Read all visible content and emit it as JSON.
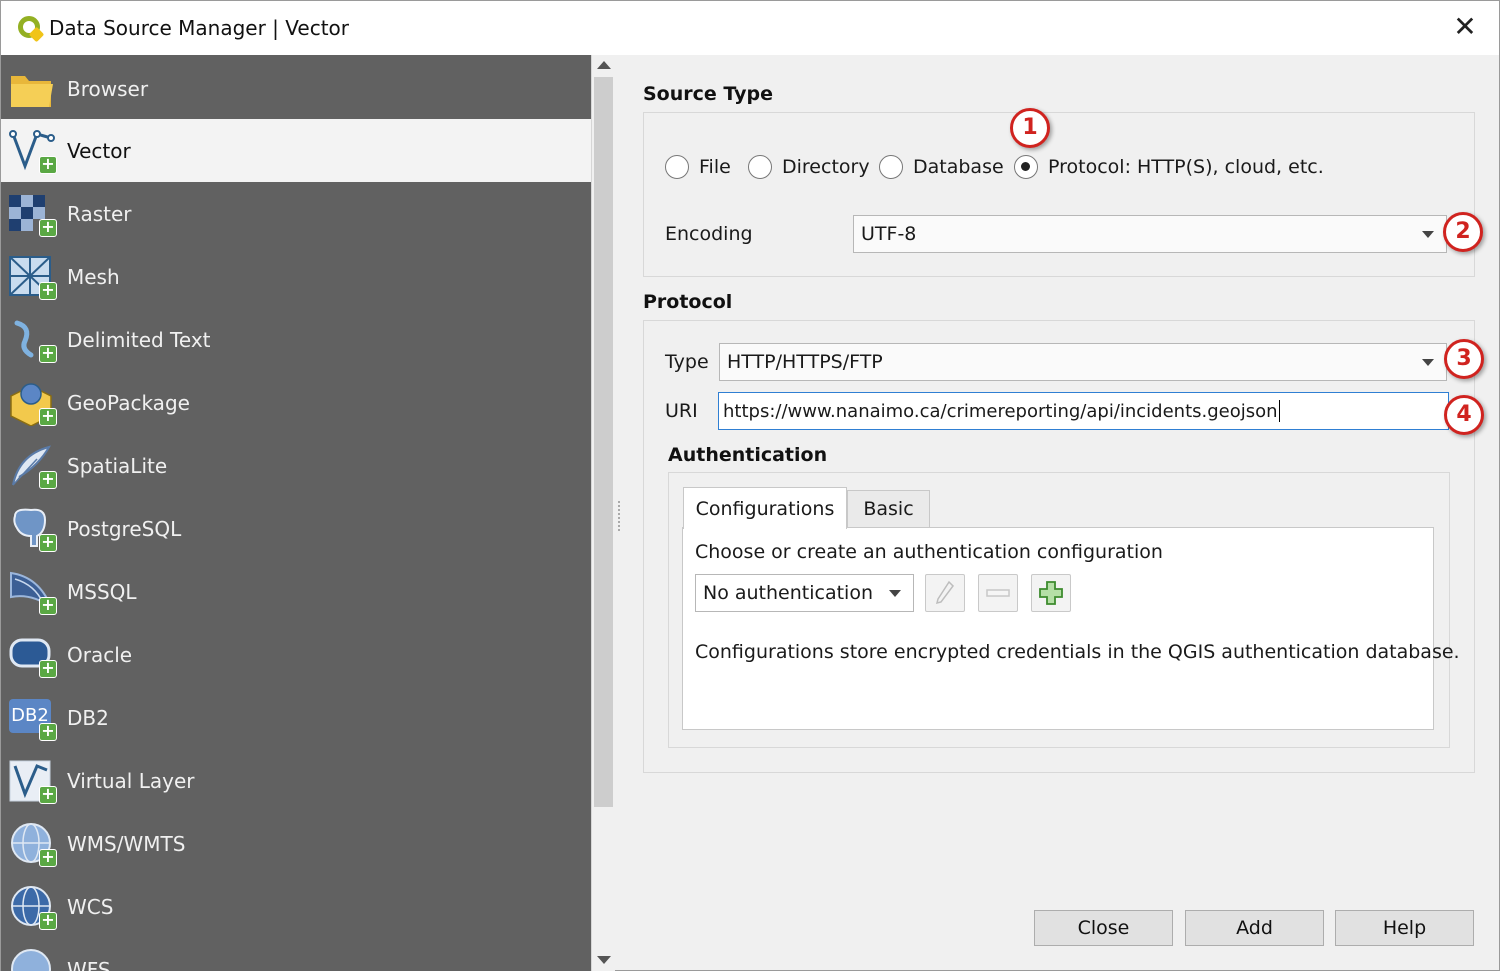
{
  "window": {
    "title": "Data Source Manager | Vector",
    "close_glyph": "✕"
  },
  "sidebar": {
    "items": [
      {
        "label": "Browser",
        "icon": "folder-icon"
      },
      {
        "label": "Vector",
        "icon": "vector-icon",
        "selected": true
      },
      {
        "label": "Raster",
        "icon": "raster-icon"
      },
      {
        "label": "Mesh",
        "icon": "mesh-icon"
      },
      {
        "label": "Delimited Text",
        "icon": "delimited-text-icon"
      },
      {
        "label": "GeoPackage",
        "icon": "geopackage-icon"
      },
      {
        "label": "SpatiaLite",
        "icon": "spatialite-icon"
      },
      {
        "label": "PostgreSQL",
        "icon": "postgresql-icon"
      },
      {
        "label": "MSSQL",
        "icon": "mssql-icon"
      },
      {
        "label": "Oracle",
        "icon": "oracle-icon"
      },
      {
        "label": "DB2",
        "icon": "db2-icon"
      },
      {
        "label": "Virtual Layer",
        "icon": "virtual-layer-icon"
      },
      {
        "label": "WMS/WMTS",
        "icon": "wms-icon"
      },
      {
        "label": "WCS",
        "icon": "wcs-icon"
      },
      {
        "label": "WFS",
        "icon": "wfs-icon"
      }
    ],
    "db2_icon_text": "DB2"
  },
  "source_type": {
    "title": "Source Type",
    "options": [
      {
        "label": "File",
        "checked": false
      },
      {
        "label": "Directory",
        "checked": false
      },
      {
        "label": "Database",
        "checked": false
      },
      {
        "label": "Protocol: HTTP(S), cloud, etc.",
        "checked": true
      }
    ],
    "encoding_label": "Encoding",
    "encoding_value": "UTF-8"
  },
  "protocol": {
    "title": "Protocol",
    "type_label": "Type",
    "type_value": "HTTP/HTTPS/FTP",
    "uri_label": "URI",
    "uri_value": "https://www.nanaimo.ca/crimereporting/api/incidents.geojson"
  },
  "authentication": {
    "title": "Authentication",
    "tabs": [
      {
        "label": "Configurations",
        "active": true
      },
      {
        "label": "Basic",
        "active": false
      }
    ],
    "prompt": "Choose or create an authentication configuration",
    "selected_config": "No authentication",
    "note": "Configurations store encrypted credentials in the QGIS authentication database."
  },
  "badges": [
    "1",
    "2",
    "3",
    "4"
  ],
  "buttons": {
    "close": "Close",
    "add": "Add",
    "help": "Help"
  },
  "colors": {
    "sidebar_bg": "#616161",
    "badge_red": "#d0231f",
    "plus_green": "#5aa844",
    "focus_blue": "#2f7fd3"
  }
}
